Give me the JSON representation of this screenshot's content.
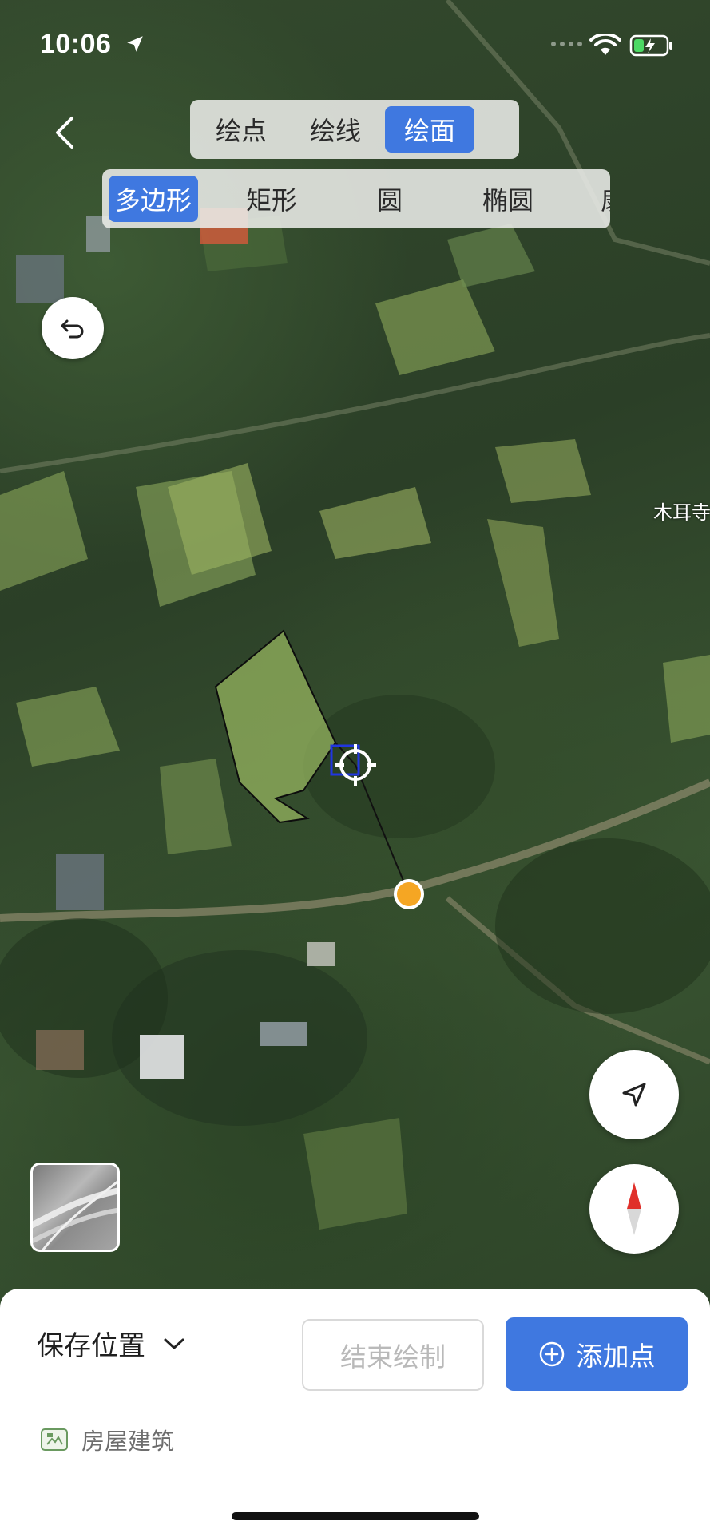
{
  "status_bar": {
    "time": "10:06"
  },
  "mode_tabs": [
    {
      "label": "绘点",
      "active": false
    },
    {
      "label": "绘线",
      "active": false
    },
    {
      "label": "绘面",
      "active": true
    }
  ],
  "shape_tabs": [
    {
      "label": "多边形",
      "active": true
    },
    {
      "label": "矩形",
      "active": false
    },
    {
      "label": "圆",
      "active": false
    },
    {
      "label": "椭圆",
      "active": false
    },
    {
      "label": "扇形",
      "active": false
    }
  ],
  "map": {
    "place_label": "木耳寺"
  },
  "bottom_panel": {
    "save_location_label": "保存位置",
    "end_draw_label": "结束绘制",
    "add_point_label": "添加点",
    "category_label": "房屋建筑"
  },
  "colors": {
    "accent": "#3f78e0",
    "point_marker": "#f5a623"
  },
  "icons": [
    "back-icon",
    "undo-icon",
    "locate-arrow-icon",
    "compass-icon",
    "chevron-down-icon",
    "plus-circle-icon",
    "category-icon"
  ]
}
